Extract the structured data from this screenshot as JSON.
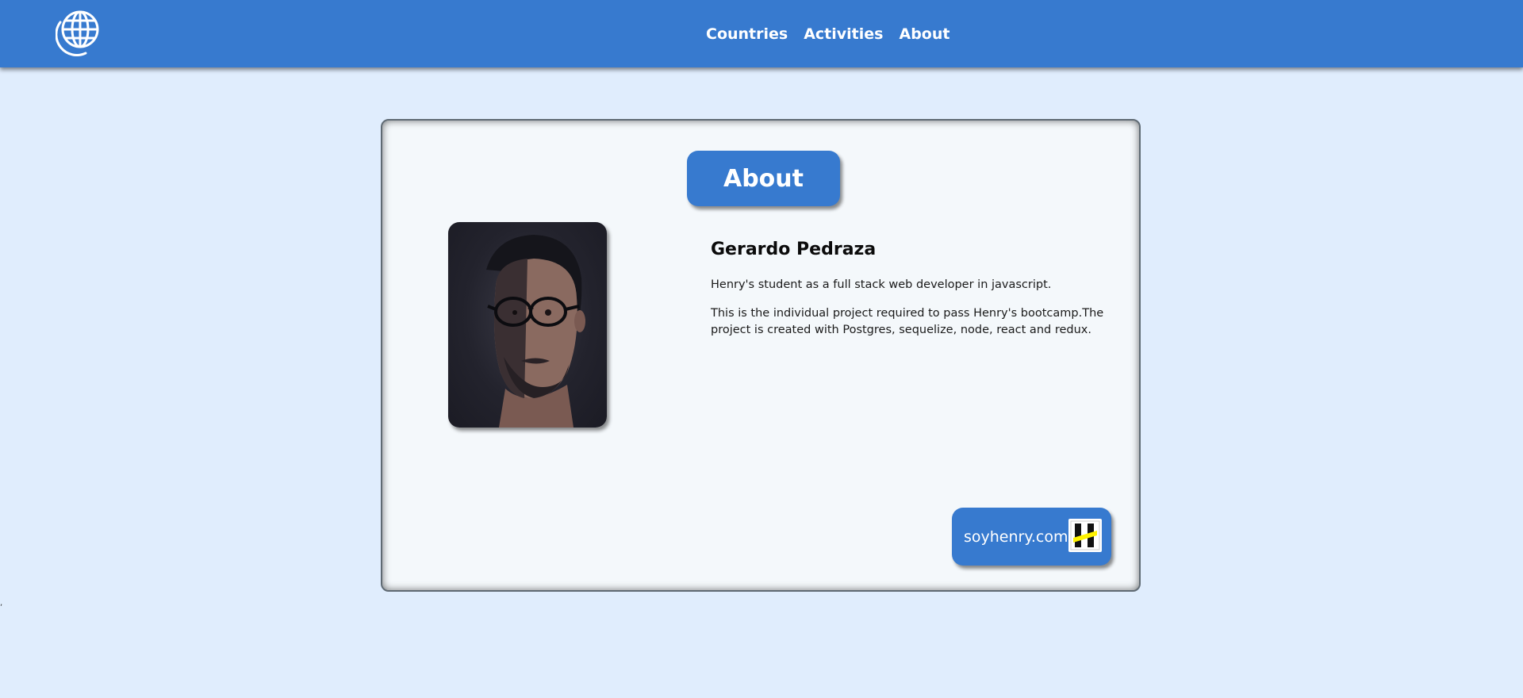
{
  "nav": {
    "logo_icon": "globe-icon",
    "links": [
      "Countries",
      "Activities",
      "About"
    ]
  },
  "card": {
    "title": "About",
    "photo_icon": "profile-photo",
    "name": "Gerardo Pedraza",
    "lines": [
      "Henry's student as a full stack web developer in javascript.",
      "This is the individual project required to pass Henry's bootcamp.The project is created with Postgres, sequelize, node, react and redux."
    ],
    "henry": {
      "label": "soyhenry.com",
      "logo_icon": "henry-logo-icon"
    }
  },
  "stray_text": ",",
  "colors": {
    "primary": "#377acf",
    "page_background": "#e0edfd",
    "card_background": "#f4f8fb",
    "henry_yellow": "#fff200"
  }
}
